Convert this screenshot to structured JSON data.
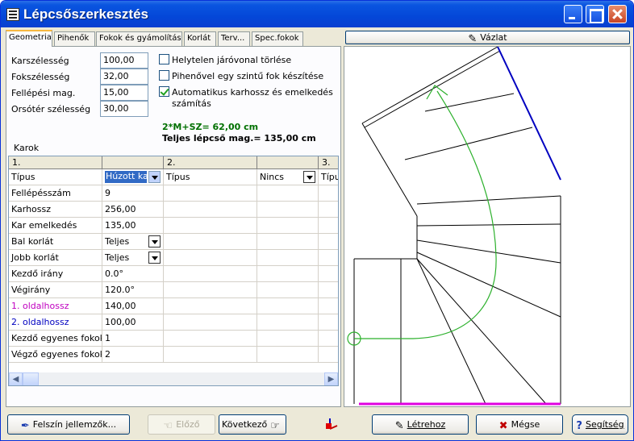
{
  "window": {
    "title": "Lépcsőszerkesztés"
  },
  "tabs": [
    "Geometria",
    "Pihenők",
    "Fokok és gyámolítás",
    "Korlát",
    "Terv...",
    "Spec.fokok"
  ],
  "fields": [
    {
      "label": "Karszélesség",
      "value": "100,00"
    },
    {
      "label": "Fokszélesség",
      "value": "32,00"
    },
    {
      "label": "Fellépési mag.",
      "value": "15,00"
    },
    {
      "label": "Orsótér szélesség",
      "value": "30,00"
    }
  ],
  "checkboxes": [
    {
      "label": "Helytelen járóvonal törlése",
      "checked": false
    },
    {
      "label": "Pihenővel egy szintű fok készítése",
      "checked": false
    },
    {
      "label": "Automatikus karhossz és emelkedés",
      "label2": "számítás",
      "checked": true
    }
  ],
  "formula": "2*M+SZ= 62,00 cm",
  "total_height": "Teljes lépcső mag.= 135,00 cm",
  "grid": {
    "title": "Karok",
    "headers": [
      "1.",
      "",
      "2.",
      "",
      "3."
    ],
    "row0": {
      "label": "Típus",
      "value": "Húzott kar",
      "col2_label": "Típus",
      "col2_value": "Nincs",
      "col3_label": "Típu"
    },
    "rows": [
      {
        "label": "Fellépésszám",
        "value": "9"
      },
      {
        "label": "Karhossz",
        "value": "256,00"
      },
      {
        "label": "Kar emelkedés",
        "value": "135,00"
      },
      {
        "label": "Bal korlát",
        "value": "Teljes",
        "dropdown": true
      },
      {
        "label": "Jobb korlát",
        "value": "Teljes",
        "dropdown": true
      },
      {
        "label": "Kezdő irány",
        "value": "0.0°"
      },
      {
        "label": "Végirány",
        "value": "120.0°"
      },
      {
        "label": "1. oldalhossz",
        "value": "140,00",
        "color": "#c000c0"
      },
      {
        "label": "2. oldalhossz",
        "value": "100,00",
        "color": "#0000c0"
      },
      {
        "label": "Kezdő egyenes fokok",
        "value": "1"
      },
      {
        "label": "Végző egyenes fokok",
        "value": "2"
      }
    ]
  },
  "sketch_button": "Vázlat",
  "buttons": {
    "surface": "Felszín jellemzők...",
    "prev": "Előző",
    "next": "Következő",
    "create": "Létrehoz",
    "cancel": "Mégse",
    "help": "Segítség"
  },
  "colors": {
    "highlight": "#316ac5",
    "formula": "#007000",
    "walkline": "#2bb02b",
    "edge_blue": "#0000c0",
    "edge_magenta": "#e000e0"
  }
}
